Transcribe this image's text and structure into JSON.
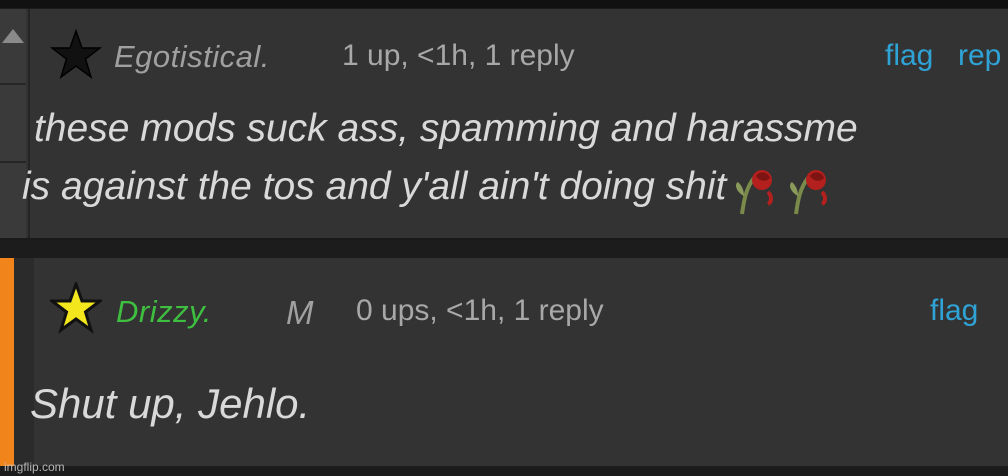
{
  "comments": [
    {
      "username": "Egotistical.",
      "meta": "1 up, <1h, 1 reply",
      "flag_label": "flag",
      "reply_label": "rep",
      "body_line1": "these mods suck ass, spamming and harassme",
      "body_line2": "is against the tos and y'all ain't doing shit",
      "colors": {
        "username": "#a0a0a0",
        "star": "#111111"
      }
    },
    {
      "username": "Drizzy.",
      "mod_badge": "M",
      "meta": "0 ups, <1h, 1 reply",
      "flag_label": "flag",
      "body": "Shut up, Jehlo.",
      "colors": {
        "username": "#3fbf3f",
        "star": "#f3e61d",
        "side_bar": "#f2841c"
      }
    }
  ],
  "icons": [
    "upvote-arrow-icon",
    "black-star-icon",
    "yellow-star-icon",
    "wilted-rose-icon"
  ],
  "watermark": "imgflip.com"
}
